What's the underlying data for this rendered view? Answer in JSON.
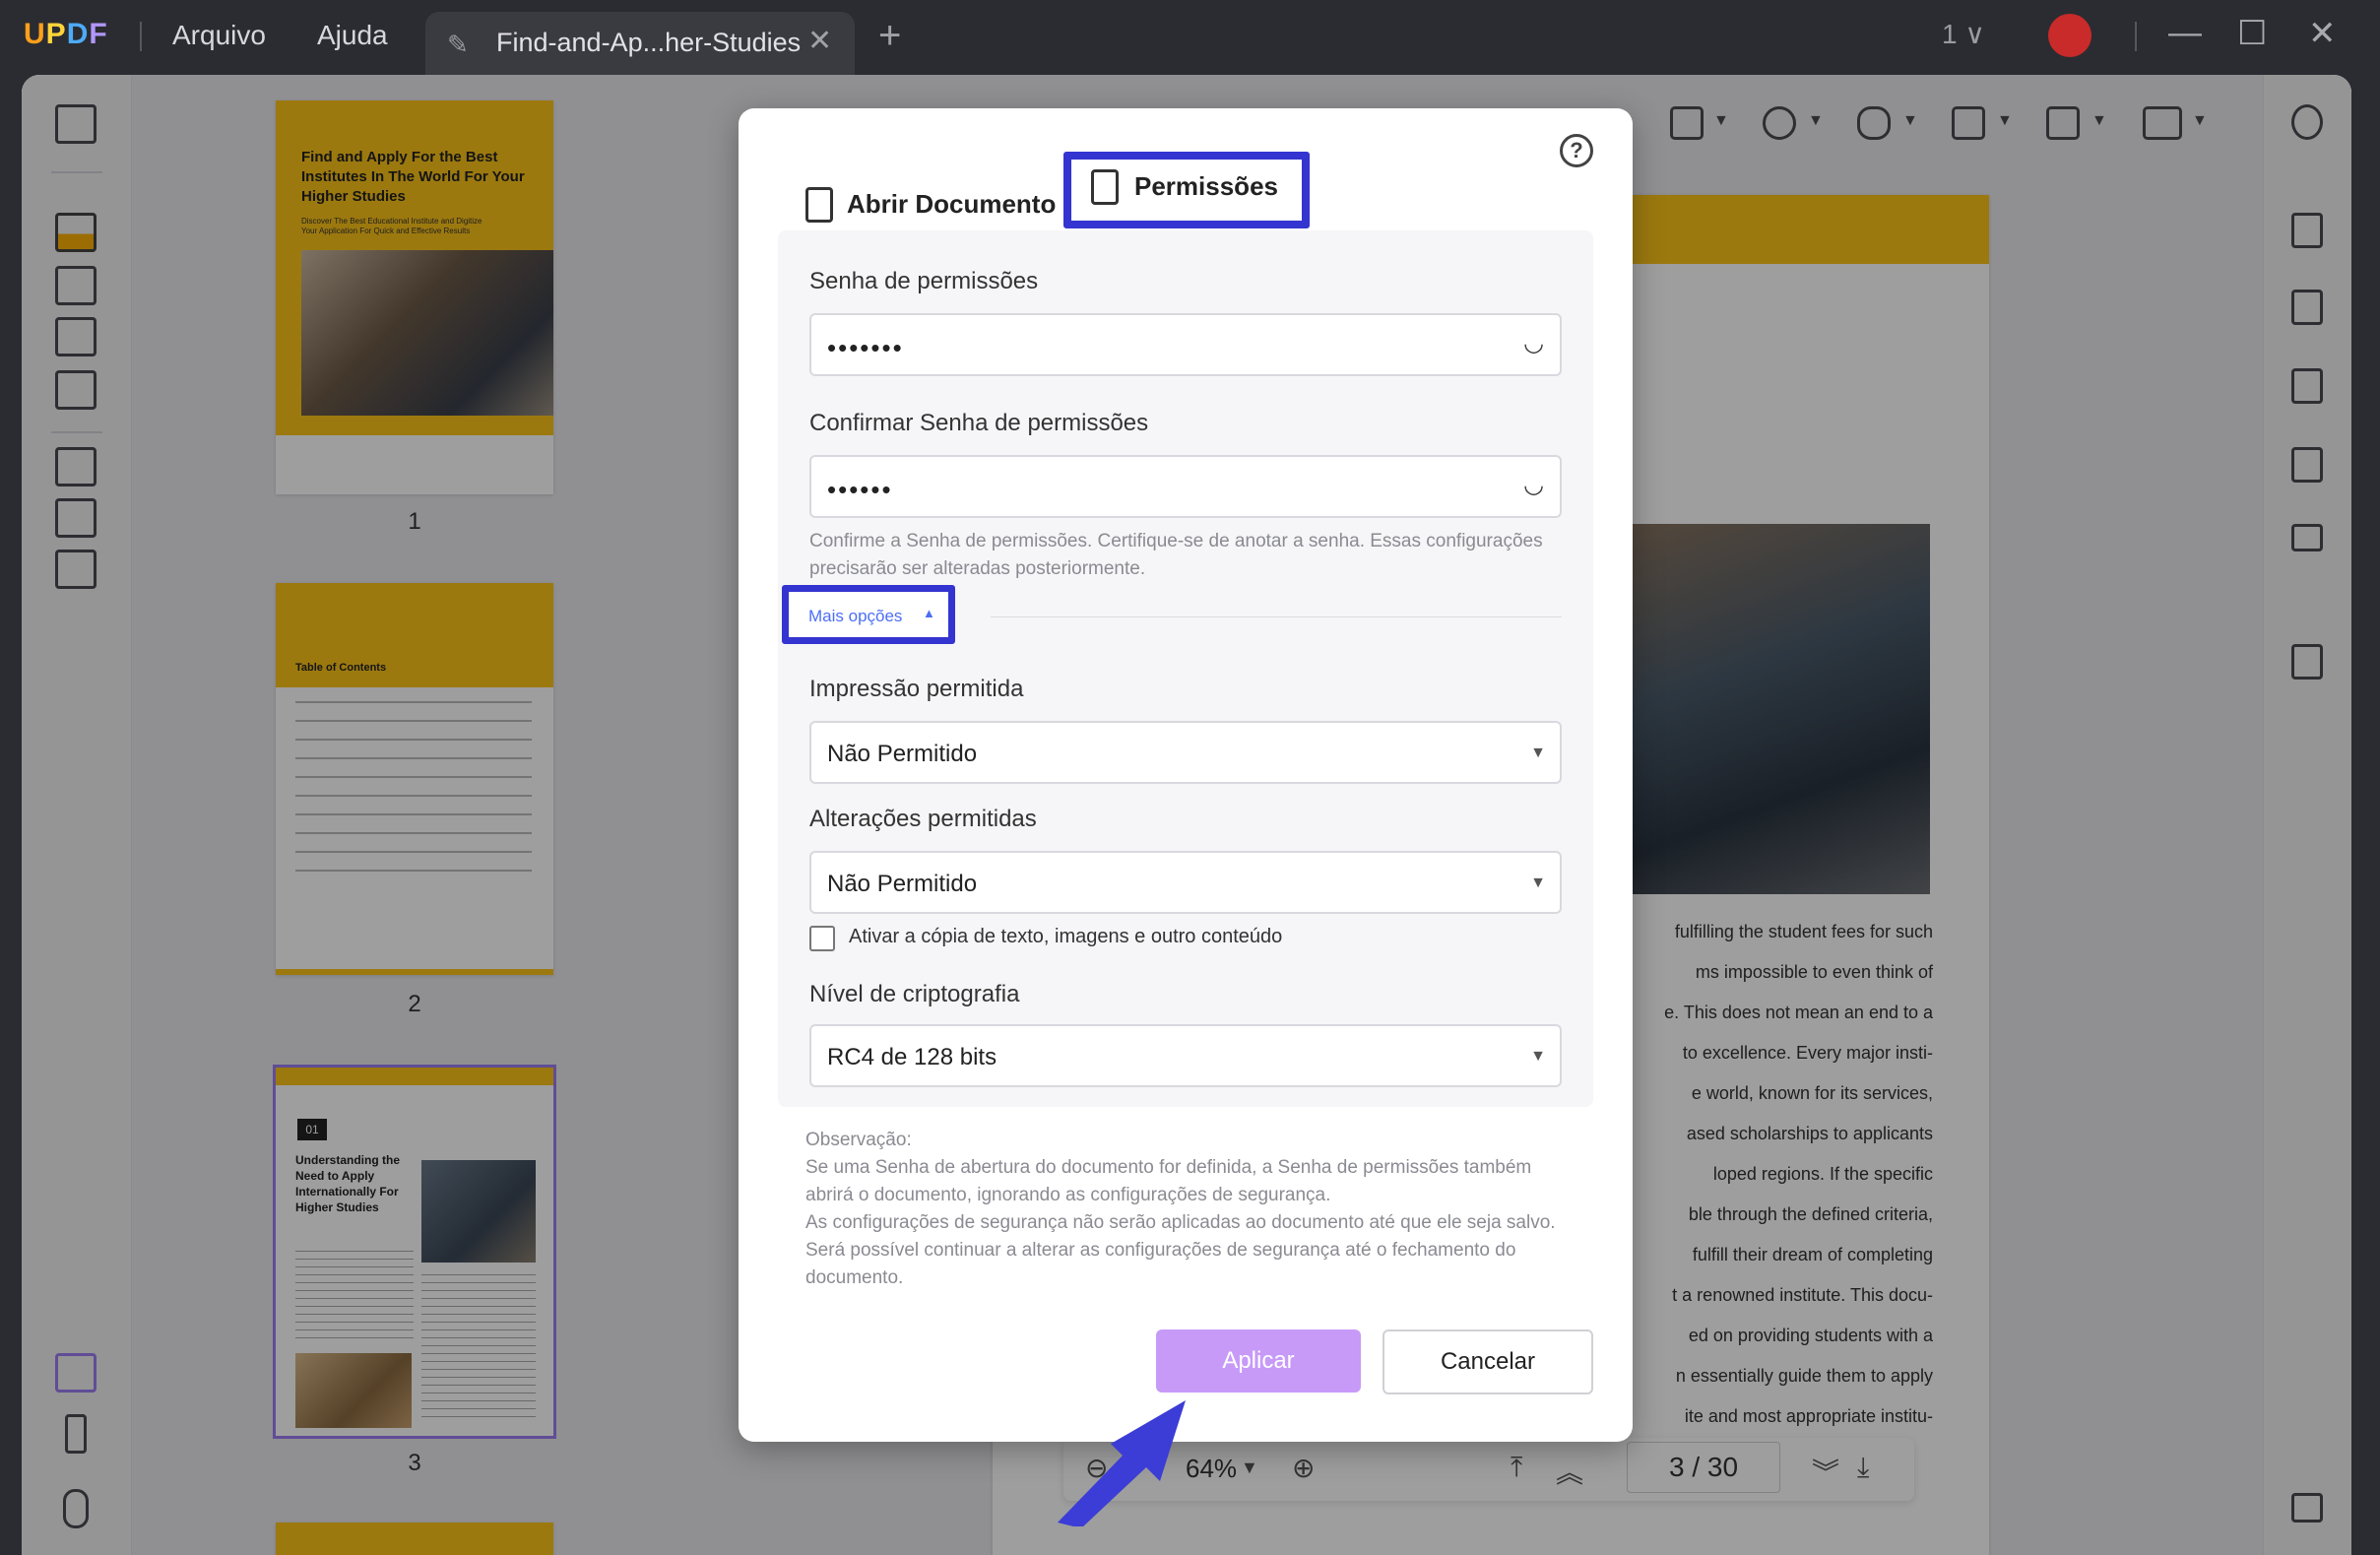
{
  "app": {
    "logo": "UPDF",
    "menu": [
      "Arquivo",
      "Ajuda"
    ],
    "tab_title": "Find-and-Ap...her-Studies",
    "page_indicator": "1 ∨",
    "colors": {
      "accent": "#3434d0",
      "apply": "#c79af8",
      "brand_yellow": "#fcc419"
    }
  },
  "thumbnails": {
    "pages": [
      {
        "number": "1",
        "heading": "Find and Apply For the Best Institutes In The World For Your Higher Studies",
        "sub": "Discover The Best Educational Institute and Digitize Your Application For Quick and Effective Results"
      },
      {
        "number": "2",
        "heading": "Table of Contents"
      },
      {
        "number": "3",
        "badge": "01",
        "heading": "Understanding the Need to Apply Internationally For Higher Studies"
      }
    ]
  },
  "document": {
    "text_lines": [
      "fulfilling the student fees for such",
      "ms impossible to even think of",
      "e. This does not mean an end to a",
      "to excellence. Every major insti-",
      "e world, known for its services,",
      "ased scholarships to applicants",
      "loped regions. If the specific",
      "ble through the defined criteria,",
      "fulfill their dream of completing",
      "t a renowned institute. This docu-",
      "ed on providing students with a",
      "n essentially guide them to apply",
      "ite and most appropriate institu-"
    ]
  },
  "pagenav": {
    "zoom": "64%",
    "current_page": "3",
    "separator": "/",
    "total_pages": "30"
  },
  "dialog": {
    "help": "?",
    "tabs": [
      {
        "label": "Abrir Documento",
        "active": false
      },
      {
        "label": "Permissões",
        "active": true
      }
    ],
    "permission_password": {
      "label": "Senha de permissões",
      "value": "•••••••"
    },
    "confirm_password": {
      "label": "Confirmar Senha de permissões",
      "value": "••••••"
    },
    "hint": "Confirme a Senha de permissões. Certifique-se de anotar a senha. Essas configurações precisarão ser alteradas posteriormente.",
    "more_options": "Mais opções",
    "printing": {
      "label": "Impressão permitida",
      "value": "Não Permitido"
    },
    "changes": {
      "label": "Alterações permitidas",
      "value": "Não Permitido"
    },
    "copy_checkbox": {
      "label": "Ativar a cópia de texto, imagens e outro conteúdo",
      "checked": false
    },
    "encryption": {
      "label": "Nível de criptografia",
      "value": "RC4 de 128 bits"
    },
    "note": {
      "title": "Observação:",
      "lines": [
        "Se uma Senha de abertura do documento for definida, a Senha de permissões também abrirá o documento, ignorando as configurações de segurança.",
        "As configurações de segurança não serão aplicadas ao documento até que ele seja salvo. Será possível continuar a alterar as configurações de segurança até o fechamento do documento."
      ]
    },
    "apply_label": "Aplicar",
    "cancel_label": "Cancelar"
  }
}
